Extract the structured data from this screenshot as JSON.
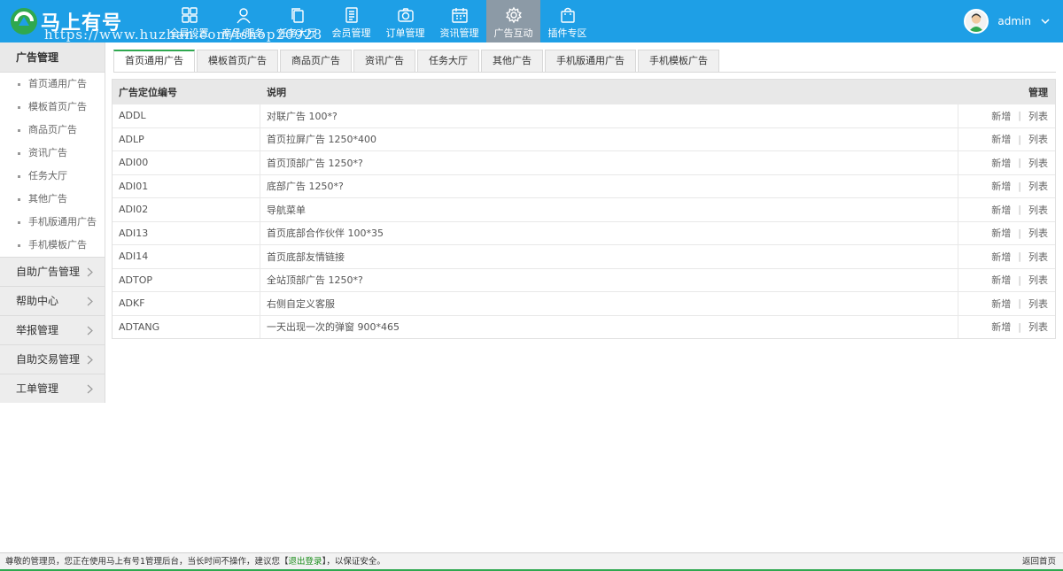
{
  "brand": {
    "logo_text": "马上有号",
    "watermark": "https://www.huzhan.com/ishop20928"
  },
  "nav": [
    {
      "label": "全局设置",
      "icon": "grid-icon"
    },
    {
      "label": "商品/服务",
      "icon": "user-icon"
    },
    {
      "label": "任务大厅",
      "icon": "copy-icon"
    },
    {
      "label": "会员管理",
      "icon": "document-icon"
    },
    {
      "label": "订单管理",
      "icon": "camera-icon"
    },
    {
      "label": "资讯管理",
      "icon": "calendar-icon"
    },
    {
      "label": "广告互动",
      "icon": "gear-icon",
      "active": true
    },
    {
      "label": "插件专区",
      "icon": "bag-icon"
    }
  ],
  "user": {
    "name": "admin"
  },
  "sidebar": {
    "title": "广告管理",
    "items": [
      "首页通用广告",
      "模板首页广告",
      "商品页广告",
      "资讯广告",
      "任务大厅",
      "其他广告",
      "手机版通用广告",
      "手机模板广告"
    ],
    "groups": [
      "自助广告管理",
      "帮助中心",
      "举报管理",
      "自助交易管理",
      "工单管理"
    ]
  },
  "tabs": [
    "首页通用广告",
    "模板首页广告",
    "商品页广告",
    "资讯广告",
    "任务大厅",
    "其他广告",
    "手机版通用广告",
    "手机模板广告"
  ],
  "table": {
    "headers": {
      "code": "广告定位编号",
      "desc": "说明",
      "manage": "管理"
    },
    "actions": {
      "add": "新增",
      "sep": "|",
      "list": "列表"
    },
    "rows": [
      {
        "code": "ADDL",
        "desc": "对联广告 100*?"
      },
      {
        "code": "ADLP",
        "desc": "首页拉屏广告 1250*400"
      },
      {
        "code": "ADI00",
        "desc": "首页顶部广告 1250*?"
      },
      {
        "code": "ADI01",
        "desc": "底部广告 1250*?"
      },
      {
        "code": "ADI02",
        "desc": "导航菜单"
      },
      {
        "code": "ADI13",
        "desc": "首页底部合作伙伴 100*35"
      },
      {
        "code": "ADI14",
        "desc": "首页底部友情链接"
      },
      {
        "code": "ADTOP",
        "desc": "全站顶部广告 1250*?"
      },
      {
        "code": "ADKF",
        "desc": "右侧自定义客服"
      },
      {
        "code": "ADTANG",
        "desc": "一天出现一次的弹窗 900*465"
      }
    ]
  },
  "footer": {
    "text_before": "尊敬的管理员，您正在使用马上有号1管理后台，当长时间不操作，建议您【",
    "logout": "退出登录",
    "text_after": "】，以保证安全。",
    "home": "返回首页"
  },
  "colors": {
    "topbar": "#1e9fe6",
    "active_nav": "#8c9aa6",
    "accent_green": "#2fa84f"
  }
}
